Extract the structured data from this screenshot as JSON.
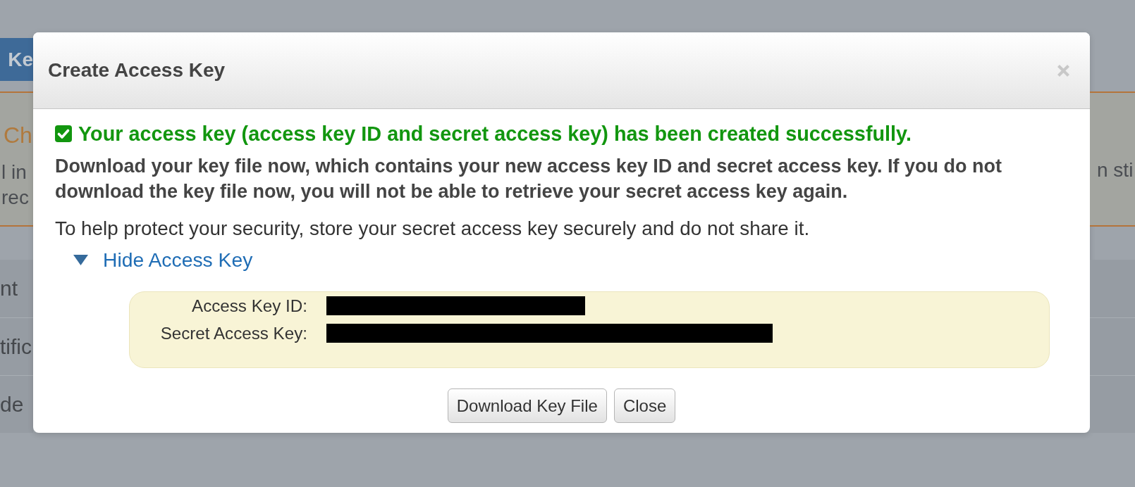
{
  "background_page": {
    "button": "Ke",
    "notice": {
      "heading": "Ch",
      "lines": [
        "l in",
        "rec"
      ],
      "right_line": "n sti"
    },
    "rows": [
      "nt",
      "tific",
      "de"
    ]
  },
  "dialog": {
    "title": "Create Access Key",
    "message": {
      "kind": "success",
      "text": "Your access key (access key ID and secret access key) has been created successfully."
    },
    "warning": "Download your key file now, which contains your new access key ID and secret access key. If you do not download the key file now, you will not be able to retrieve your secret access key again.",
    "info": "To help protect your security, store your secret access key securely and do not share it.",
    "toggle": {
      "label": "Hide Access Key",
      "expanded": true
    },
    "key_fields": [
      {
        "label": "Access Key ID:",
        "kind": "redacted"
      },
      {
        "label": "Secret Access Key:",
        "kind": "redacted"
      }
    ],
    "buttons": [
      "Download Key File",
      "Close"
    ]
  }
}
